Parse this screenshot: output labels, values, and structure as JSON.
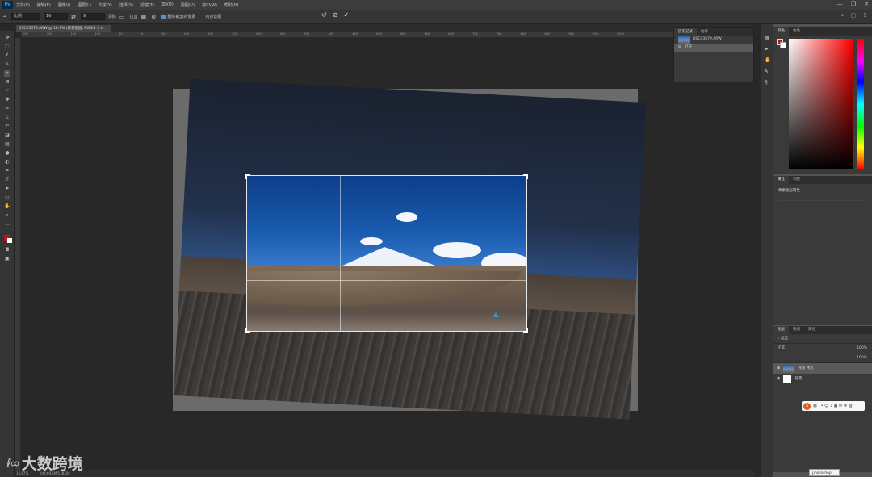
{
  "menu": {
    "app_icon": "Ps",
    "items": [
      "文件(F)",
      "编辑(E)",
      "图像(I)",
      "图层(L)",
      "文字(Y)",
      "选择(S)",
      "滤镜(T)",
      "3D(D)",
      "视图(V)",
      "窗口(W)",
      "帮助(H)"
    ]
  },
  "options": {
    "ratio_label": "比例",
    "width": "16",
    "height": "9",
    "clear_label": "清除",
    "straighten_label": "拉直",
    "delete_label": "删除裁剪的像素",
    "content_aware_label": "内容识别"
  },
  "document_tab": {
    "title": "DSC03579.ARW @ 16.7% (背景图层, RGB/8*) ×"
  },
  "ruler_ticks": "250 200 150 100 50 0 50 100 150 200 250 300 350 400 450 500 550 600 650 700 750 800 850 900 950 1000",
  "history": {
    "tabs": [
      "历史记录",
      "动作"
    ],
    "snapshot": "DSC03579.ARW",
    "row": "打开"
  },
  "color_panel": {
    "tabs": [
      "颜色",
      "色板"
    ],
    "fg_color": "#c4120e",
    "bg_color": "#ffffff"
  },
  "properties": {
    "tabs": [
      "属性",
      "调整"
    ],
    "title": "像素图层属性"
  },
  "layers": {
    "tabs": [
      "图层",
      "通道",
      "路径"
    ],
    "blend_mode": "正常",
    "opacity": "100%",
    "fill": "100%",
    "layer1": "背景 拷贝",
    "layer2": "背景"
  },
  "status": {
    "zoom": "16.67%",
    "doc_info": "文档:69.1M/138.2M"
  },
  "tooltip": "photoshop",
  "ime": {
    "lang": "英",
    "sym": "S"
  },
  "watermark": "大数跨境"
}
